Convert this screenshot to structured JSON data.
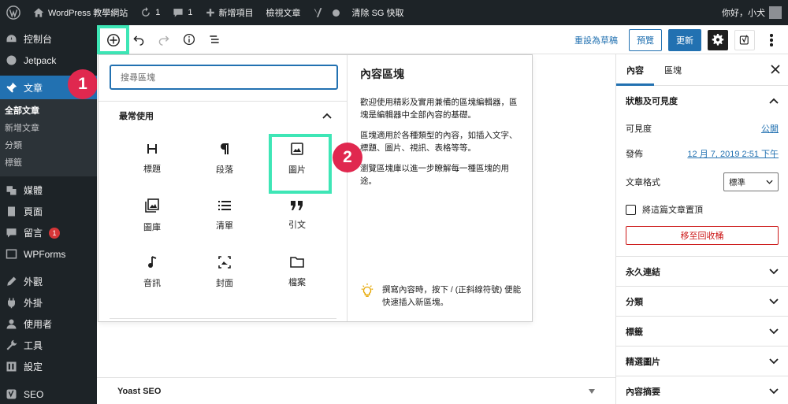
{
  "admin_bar": {
    "site_name": "WordPress 教學網站",
    "updates_count": "1",
    "comments_count": "1",
    "new_item": "新增項目",
    "view_post": "檢視文章",
    "clear_cache": "清除 SG 快取",
    "greeting": "你好，小犬"
  },
  "side_menu": {
    "items": [
      {
        "label": "控制台",
        "icon": "dashboard-icon"
      },
      {
        "label": "Jetpack",
        "icon": "jetpack-icon"
      },
      {
        "label": "文章",
        "icon": "pin-icon",
        "active": true
      },
      {
        "label": "媒體",
        "icon": "media-icon"
      },
      {
        "label": "頁面",
        "icon": "page-icon"
      },
      {
        "label": "留言",
        "icon": "comment-icon",
        "badge": "1"
      },
      {
        "label": "WPForms",
        "icon": "forms-icon"
      },
      {
        "label": "外觀",
        "icon": "appearance-icon"
      },
      {
        "label": "外掛",
        "icon": "plugin-icon"
      },
      {
        "label": "使用者",
        "icon": "user-icon"
      },
      {
        "label": "工具",
        "icon": "tools-icon"
      },
      {
        "label": "設定",
        "icon": "settings-icon"
      },
      {
        "label": "SEO",
        "icon": "yoast-icon"
      }
    ],
    "posts_submenu": [
      "全部文章",
      "新增文章",
      "分類",
      "標籤"
    ]
  },
  "toolbar": {
    "save_draft": "重設為草稿",
    "preview": "預覽",
    "update": "更新"
  },
  "inserter": {
    "search_placeholder": "搜尋區塊",
    "category": "最常使用",
    "blocks": [
      {
        "label": "標題",
        "icon": "heading-icon"
      },
      {
        "label": "段落",
        "icon": "paragraph-icon"
      },
      {
        "label": "圖片",
        "icon": "image-icon"
      },
      {
        "label": "圖庫",
        "icon": "gallery-icon"
      },
      {
        "label": "清單",
        "icon": "list-icon"
      },
      {
        "label": "引文",
        "icon": "quote-icon"
      },
      {
        "label": "音訊",
        "icon": "audio-icon"
      },
      {
        "label": "封面",
        "icon": "cover-icon"
      },
      {
        "label": "檔案",
        "icon": "file-icon"
      }
    ],
    "info_title": "內容區塊",
    "info_p1": "歡迎使用精彩及實用兼備的區塊編輯器，區塊是編輯器中全部內容的基礎。",
    "info_p2": "區塊適用於各種類型的內容，如插入文字、標題、圖片、視訊、表格等等。",
    "info_p3": "瀏覽區塊庫以進一步瞭解每一種區塊的用途。",
    "tip": "撰寫內容時，按下 / (正斜線符號) 便能快速插入新區塊。"
  },
  "steps": {
    "one": "1",
    "two": "2"
  },
  "yoast_panel": "Yoast SEO",
  "sidebar": {
    "tab_document": "內容",
    "tab_block": "區塊",
    "status_title": "狀態及可見度",
    "visibility_label": "可見度",
    "visibility_value": "公開",
    "publish_label": "發佈",
    "publish_value": "12 月 7, 2019 2:51 下午",
    "format_label": "文章格式",
    "format_value": "標準",
    "sticky_label": "將這篇文章置頂",
    "trash": "移至回收桶",
    "panels": [
      "永久連結",
      "分類",
      "標籤",
      "精選圖片",
      "內容摘要"
    ]
  },
  "colors": {
    "accent": "#2271b1",
    "highlight": "#3ee6b6",
    "step": "#e0284f",
    "admin_bg": "#1d2327"
  }
}
